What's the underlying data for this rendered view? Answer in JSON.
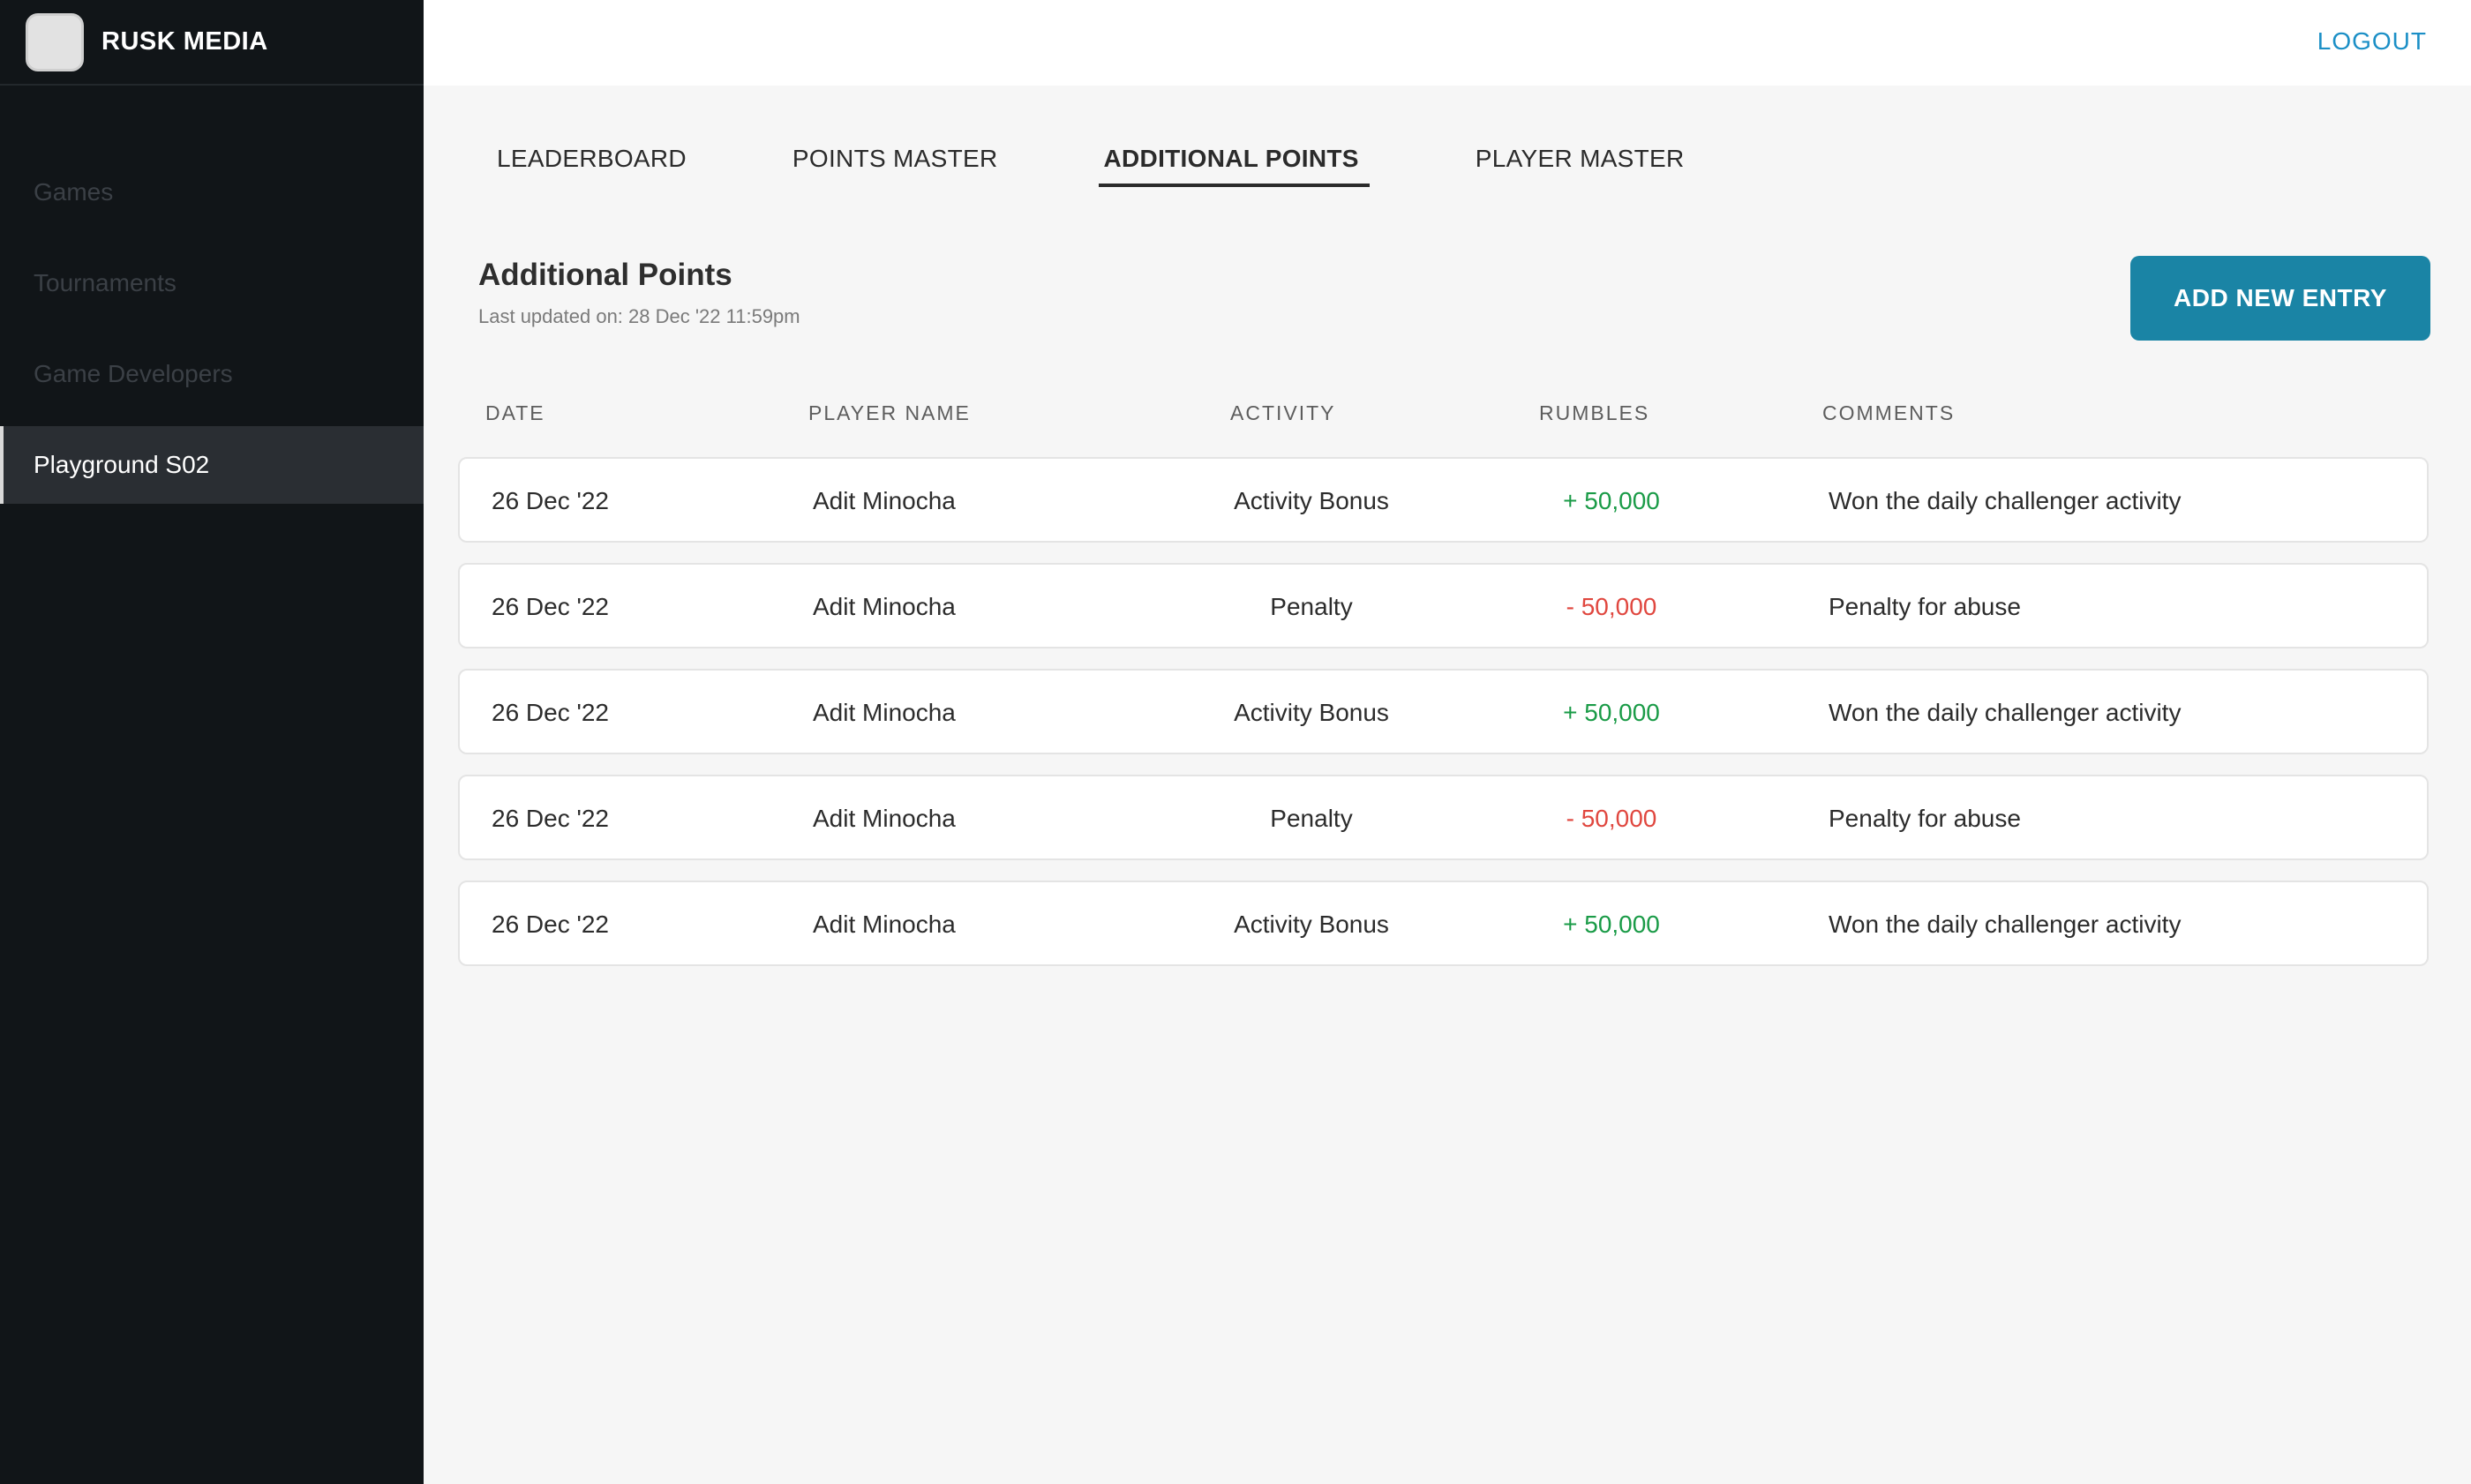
{
  "brand": {
    "name": "RUSK MEDIA"
  },
  "sidebar": {
    "items": [
      {
        "label": "Games",
        "active": false
      },
      {
        "label": "Tournaments",
        "active": false
      },
      {
        "label": "Game Developers",
        "active": false
      },
      {
        "label": "Playground S02",
        "active": true
      }
    ]
  },
  "topbar": {
    "logout_label": "LOGOUT"
  },
  "tabs": [
    {
      "label": "LEADERBOARD",
      "active": false
    },
    {
      "label": "POINTS MASTER",
      "active": false
    },
    {
      "label": "ADDITIONAL POINTS",
      "active": true
    },
    {
      "label": "PLAYER MASTER",
      "active": false
    }
  ],
  "page": {
    "title": "Additional Points",
    "last_updated": "Last updated on: 28 Dec '22 11:59pm",
    "add_button_label": "ADD NEW ENTRY"
  },
  "table": {
    "columns": [
      "DATE",
      "PLAYER NAME",
      "ACTIVITY",
      "RUMBLES",
      "COMMENTS"
    ],
    "rows": [
      {
        "date": "26 Dec '22",
        "player": "Adit Minocha",
        "activity": "Activity Bonus",
        "rumbles": "+ 50,000",
        "type": "positive",
        "comment": "Won the daily challenger activity"
      },
      {
        "date": "26 Dec '22",
        "player": "Adit Minocha",
        "activity": "Penalty",
        "rumbles": "- 50,000",
        "type": "negative",
        "comment": "Penalty for abuse"
      },
      {
        "date": "26 Dec '22",
        "player": "Adit Minocha",
        "activity": "Activity Bonus",
        "rumbles": "+ 50,000",
        "type": "positive",
        "comment": "Won the daily challenger activity"
      },
      {
        "date": "26 Dec '22",
        "player": "Adit Minocha",
        "activity": "Penalty",
        "rumbles": "- 50,000",
        "type": "negative",
        "comment": "Penalty for abuse"
      },
      {
        "date": "26 Dec '22",
        "player": "Adit Minocha",
        "activity": "Activity Bonus",
        "rumbles": "+ 50,000",
        "type": "positive",
        "comment": "Won the daily challenger activity"
      }
    ]
  },
  "colors": {
    "sidebar_bg": "#111518",
    "accent_button": "#1a84a5",
    "logout_link": "#1b8fc6",
    "positive": "#1a9b47",
    "negative": "#e0473f"
  }
}
